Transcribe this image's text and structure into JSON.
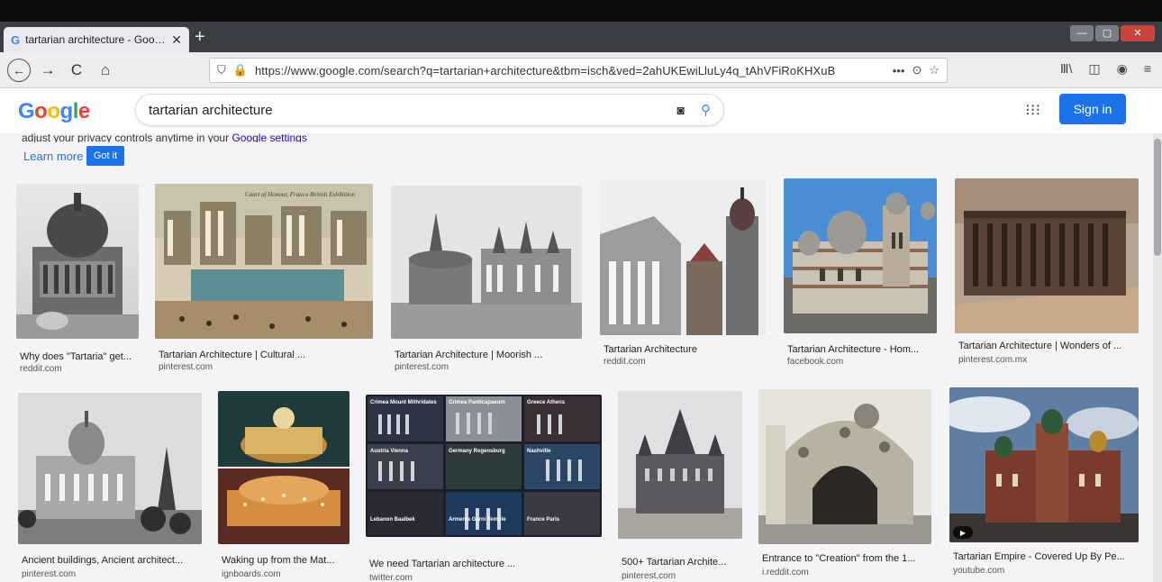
{
  "browser": {
    "tab_title": "tartarian architecture - Google",
    "tab_favicon": "G",
    "url": "https://www.google.com/search?q=tartarian+architecture&tbm=isch&ved=2ahUKEwiLluLy4q_tAhVFiRoKHXuB"
  },
  "icons": {
    "close": "✕",
    "new_tab": "+",
    "back": "←",
    "forward": "→",
    "reload": "C",
    "home": "⌂",
    "shield": "⛉",
    "lock": "🔒",
    "more": "•••",
    "pocket": "⊙",
    "star": "☆",
    "library": "Ⅲ\\",
    "sidebar": "◫",
    "account": "◉",
    "menu": "≡",
    "camera": "◙",
    "search": "⚲",
    "apps": "⁝⁝⁝",
    "minimize": "—",
    "maximize": "▢",
    "window_close": "✕"
  },
  "header": {
    "search_query": "tartarian architecture",
    "sign_in_label": "Sign in"
  },
  "notice": {
    "text": "adjust your privacy controls anytime in your ",
    "link": "Google settings",
    "learn_more": "Learn more",
    "got_it": "Got it"
  },
  "results": [
    {
      "caption": "Why does \"Tartaria\" get...",
      "source": "reddit.com"
    },
    {
      "caption": "Tartarian Architecture | Cultural ...",
      "source": "pinterest.com"
    },
    {
      "caption": "Tartarian Architecture | Moorish ...",
      "source": "pinterest.com"
    },
    {
      "caption": "Tartarian Architecture",
      "source": "reddit.com"
    },
    {
      "caption": "Tartarian Architecture - Hom...",
      "source": "facebook.com"
    },
    {
      "caption": "Tartarian Architecture | Wonders of ...",
      "source": "pinterest.com.mx"
    },
    {
      "caption": "Ancient buildings, Ancient architect...",
      "source": "pinterest.com"
    },
    {
      "caption": "Waking up from the Mat...",
      "source": "ignboards.com"
    },
    {
      "caption": "We need Tartarian architecture ...",
      "source": "twitter.com"
    },
    {
      "caption": "500+ Tartarian Archite...",
      "source": "pinterest.com"
    },
    {
      "caption": "Entrance to \"Creation\" from the 1...",
      "source": "i.reddit.com"
    },
    {
      "caption": "Tartarian Empire - Covered Up By Pe...",
      "source": "youtube.com"
    }
  ],
  "thumb_labels": {
    "court_of_honour": "Court of Honour, Franco British Exhibition",
    "collage": [
      "Crimea Mount Mithridates",
      "Crimea Panticapaeum",
      "Greece Athens",
      "Austria Vienna",
      "Germany Regensburg",
      "Nashville",
      "Lebanon Baalbek",
      "Armenia Garni Temple",
      "France Paris"
    ]
  },
  "colors": {
    "accent": "#1a73e8",
    "link": "#1a0dab"
  }
}
